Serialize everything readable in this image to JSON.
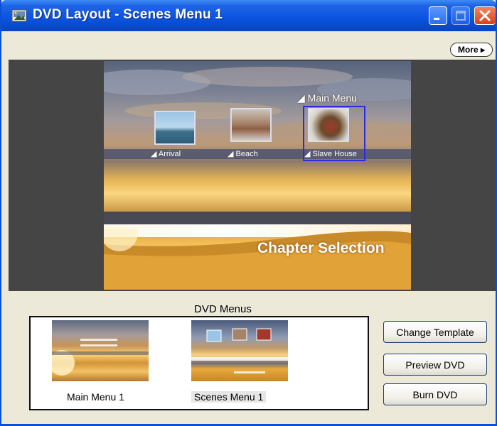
{
  "window": {
    "title": "DVD Layout - Scenes Menu 1",
    "more_label": "More ▸"
  },
  "preview": {
    "main_menu_link": "◢ Main Menu",
    "chapter_title": "Chapter Selection",
    "scenes": [
      {
        "label": "◢ Arrival"
      },
      {
        "label": "◢ Beach"
      },
      {
        "label": "◢ Slave House",
        "selected": true
      }
    ],
    "selection_color": "#2b2bdf"
  },
  "menus_panel": {
    "heading": "DVD Menus",
    "items": [
      {
        "caption": "Main Menu 1"
      },
      {
        "caption": "Scenes Menu 1",
        "selected": true
      }
    ]
  },
  "actions": {
    "change_template": "Change Template",
    "preview_dvd": "Preview DVD",
    "burn_dvd": "Burn DVD"
  },
  "colors": {
    "titlebar": "#0b55e2",
    "window_bg": "#ece9d8",
    "preview_bg": "#454545"
  }
}
